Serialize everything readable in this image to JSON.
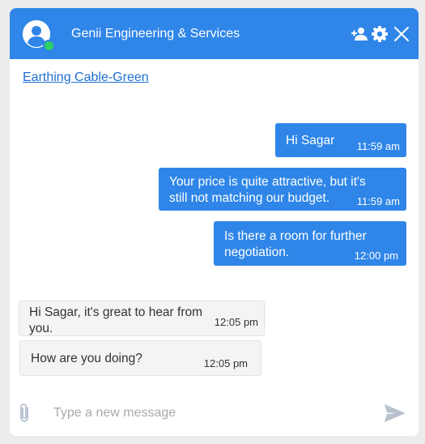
{
  "header": {
    "title": "Genii Engineering & Services",
    "icons": [
      "add-user-icon",
      "gear-icon",
      "close-icon"
    ],
    "status": "online"
  },
  "product_link": "Earthing Cable-Green",
  "messages": [
    {
      "direction": "sent",
      "text": "Hi Sagar",
      "time": "11:59 am"
    },
    {
      "direction": "sent",
      "text": "Your price is quite attractive, but it's\nstill not matching our budget.",
      "time": "11:59 am"
    },
    {
      "direction": "sent",
      "text": "Is there a room for further\nnegotiation.",
      "time": "12:00 pm"
    },
    {
      "direction": "received",
      "text": "Hi Sagar, it's great to hear from\nyou.",
      "time": "12:05 pm"
    },
    {
      "direction": "received",
      "text": "How are you doing?",
      "time": "12:05 pm"
    }
  ],
  "composer": {
    "placeholder": "Type a new message",
    "value": ""
  },
  "colors": {
    "accent": "#2f86e8",
    "online": "#2fd065",
    "received_bg": "#f4f4f4",
    "link": "#1f6fd1"
  }
}
